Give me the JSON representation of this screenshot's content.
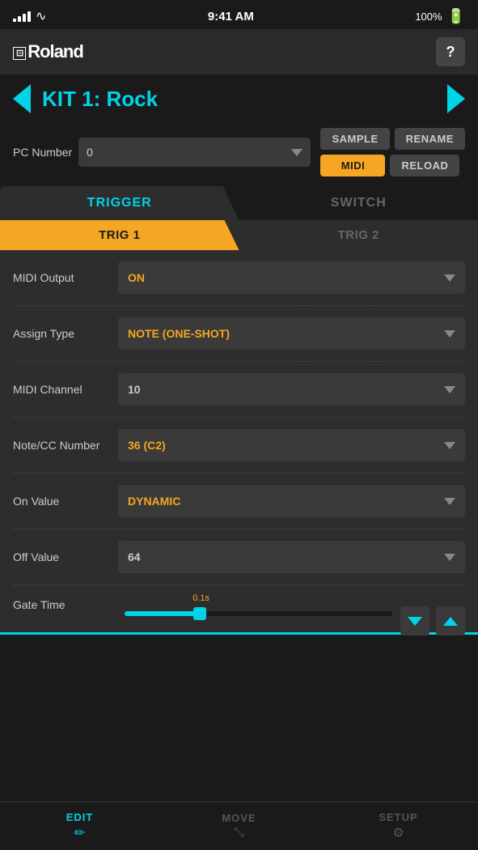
{
  "status": {
    "time": "9:41 AM",
    "battery": "100%"
  },
  "header": {
    "logo": "Roland",
    "help_label": "?"
  },
  "kit_nav": {
    "title": "KIT 1: Rock"
  },
  "top_controls": {
    "pc_label": "PC Number",
    "pc_value": "0",
    "btn_sample": "SAMPLE",
    "btn_rename": "RENAME",
    "btn_midi": "MIDI",
    "btn_reload": "RELOAD"
  },
  "tabs": {
    "main": [
      {
        "id": "trigger",
        "label": "TRIGGER",
        "active": true
      },
      {
        "id": "switch",
        "label": "SWITCH",
        "active": false
      }
    ],
    "sub": [
      {
        "id": "trig1",
        "label": "TRIG 1",
        "active": true
      },
      {
        "id": "trig2",
        "label": "TRIG 2",
        "active": false
      }
    ]
  },
  "settings": [
    {
      "id": "midi-output",
      "label": "MIDI Output",
      "value": "ON",
      "value_style": "orange"
    },
    {
      "id": "assign-type",
      "label": "Assign Type",
      "value": "NOTE (ONE-SHOT)",
      "value_style": "orange"
    },
    {
      "id": "midi-channel",
      "label": "MIDI Channel",
      "value": "10",
      "value_style": "white"
    },
    {
      "id": "note-cc-number",
      "label": "Note/CC Number",
      "value": "36 (C2)",
      "value_style": "orange"
    },
    {
      "id": "on-value",
      "label": "On Value",
      "value": "DYNAMIC",
      "value_style": "orange"
    },
    {
      "id": "off-value",
      "label": "Off Value",
      "value": "64",
      "value_style": "white"
    }
  ],
  "gate_time": {
    "label": "Gate Time",
    "value": "0.1s",
    "slider_percent": 28
  },
  "bottom_nav": [
    {
      "id": "edit",
      "label": "EDIT",
      "active": true,
      "icon": "pencil"
    },
    {
      "id": "move",
      "label": "MOVE",
      "active": false,
      "icon": "move"
    },
    {
      "id": "setup",
      "label": "SETUP",
      "active": false,
      "icon": "gear"
    }
  ]
}
